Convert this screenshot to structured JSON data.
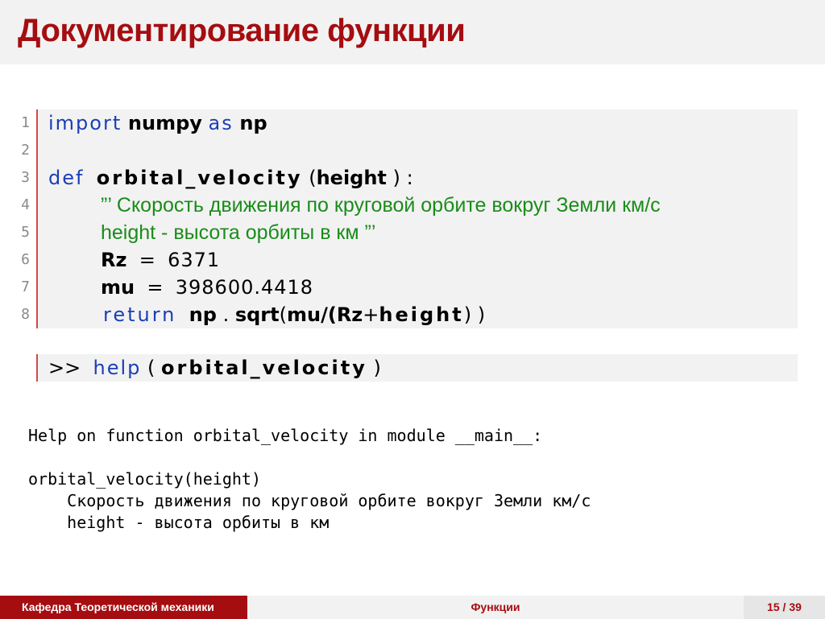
{
  "slide": {
    "title": "Документирование функции"
  },
  "code": {
    "line_numbers": [
      "1",
      "2",
      "3",
      "4",
      "5",
      "6",
      "7",
      "8"
    ],
    "l1": {
      "import": "import",
      "numpy": "numpy",
      "as": "as",
      "np": "np"
    },
    "l3": {
      "def": "def",
      "name": "orbital_velocity",
      "open": "(",
      "param": "height",
      "close": ")",
      "colon": ":"
    },
    "l4": {
      "doc": "”’ Скорость движения по круговой орбите вокруг Земли км/с"
    },
    "l5": {
      "doc": "height - высота орбиты в км ”’"
    },
    "l6": {
      "var": "Rz",
      "eq": "=",
      "val": "6371"
    },
    "l7": {
      "var": "mu",
      "eq": "=",
      "val": "398600.4418"
    },
    "l8": {
      "ret": "return",
      "np": "np",
      "dot": ".",
      "sqrt": "sqrt",
      "open": "(",
      "mu": "mu/(",
      "rz": "Rz",
      "plus": "+",
      "height": "height",
      "close": ")",
      "close2": ")"
    }
  },
  "help_call": {
    "prompt": ">>",
    "fn": "help",
    "open": "(",
    "arg": "orbital_velocity",
    "close": ")"
  },
  "output": {
    "line1": "Help on function orbital_velocity in module __main__:",
    "line2": "",
    "line3": "orbital_velocity(height)",
    "line4": "    Скорость движения по круговой орбите вокруг Земли км/с",
    "line5": "    height - высота орбиты в км"
  },
  "footer": {
    "department": "Кафедра Теоретической механики",
    "section": "Функции",
    "page": "15 / 39"
  }
}
